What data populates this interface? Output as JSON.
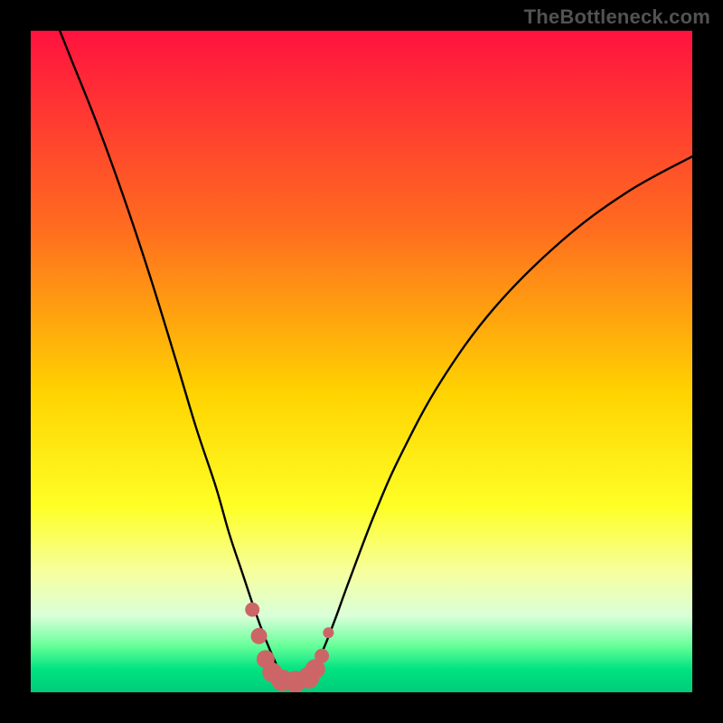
{
  "watermark": "TheBottleneck.com",
  "colors": {
    "frame": "#000000",
    "marker": "#CC6666",
    "curve": "#000000"
  },
  "chart_data": {
    "type": "line",
    "title": "",
    "xlabel": "",
    "ylabel": "",
    "xlim": [
      0,
      100
    ],
    "ylim": [
      0,
      100
    ],
    "gradient_stops": [
      {
        "offset": 0.0,
        "color": "#ff123f"
      },
      {
        "offset": 0.3,
        "color": "#ff6d1f"
      },
      {
        "offset": 0.55,
        "color": "#ffd400"
      },
      {
        "offset": 0.72,
        "color": "#feff26"
      },
      {
        "offset": 0.82,
        "color": "#f6ffa0"
      },
      {
        "offset": 0.885,
        "color": "#d9ffd9"
      },
      {
        "offset": 0.93,
        "color": "#66ff99"
      },
      {
        "offset": 0.965,
        "color": "#00e381"
      },
      {
        "offset": 1.0,
        "color": "#00cc7a"
      }
    ],
    "series": [
      {
        "name": "bottleneck-curve",
        "x": [
          2,
          6,
          10,
          14,
          18,
          22,
          25,
          28,
          30,
          32,
          34,
          35.5,
          37,
          38,
          39,
          40,
          41,
          42,
          44,
          46,
          48,
          52,
          56,
          62,
          70,
          80,
          90,
          100
        ],
        "y": [
          106,
          96,
          86,
          75,
          63,
          50,
          40,
          31,
          24,
          18,
          12,
          8,
          4.5,
          2.5,
          1.2,
          0.8,
          1.2,
          2.5,
          6,
          11,
          16.5,
          27,
          36,
          47,
          58,
          68,
          75.5,
          81
        ]
      }
    ],
    "markers": {
      "name": "highlight-band",
      "x": [
        33.5,
        34.5,
        35.5,
        36.5,
        38,
        40,
        42,
        43,
        44,
        45
      ],
      "y": [
        12.5,
        8.5,
        5.0,
        3.0,
        1.8,
        1.6,
        2.2,
        3.5,
        5.5,
        9.0
      ],
      "r": [
        8,
        9,
        10,
        11,
        12,
        12,
        12,
        11,
        8,
        6
      ]
    }
  }
}
